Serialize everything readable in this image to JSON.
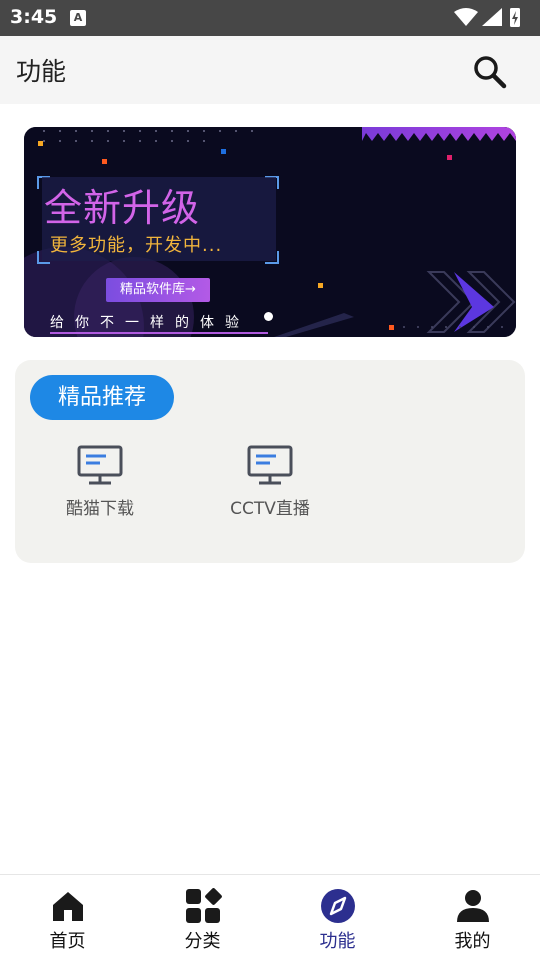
{
  "status_bar": {
    "time": "3:45",
    "notification_icon": "A"
  },
  "app_bar": {
    "title": "功能",
    "search_icon": "search-icon"
  },
  "banner": {
    "headline": "全新升级",
    "subtitle": "更多功能，开发中...",
    "button": "精品软件库→",
    "slogan": "给你不一样的体验"
  },
  "recommend": {
    "badge": "精品推荐",
    "items": [
      {
        "label": "酷猫下载",
        "icon": "monitor-icon"
      },
      {
        "label": "CCTV直播",
        "icon": "monitor-icon"
      }
    ]
  },
  "nav": {
    "items": [
      {
        "label": "首页",
        "icon": "home-icon"
      },
      {
        "label": "分类",
        "icon": "category-icon"
      },
      {
        "label": "功能",
        "icon": "compass-icon",
        "active": true
      },
      {
        "label": "我的",
        "icon": "person-icon"
      }
    ]
  },
  "colors": {
    "accent_blue": "#1e88e5",
    "nav_active": "#2c2f8f",
    "banner_headline": "#d264e8",
    "banner_sub": "#f2b53c"
  }
}
